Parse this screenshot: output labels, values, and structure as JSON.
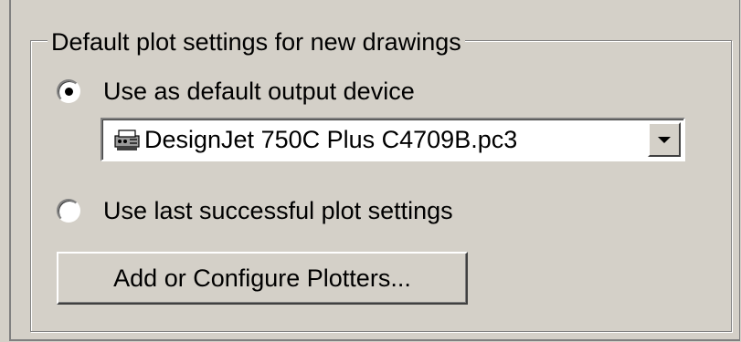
{
  "group": {
    "legend": "Default plot settings for new drawings"
  },
  "output_options": {
    "default_device_label": "Use as default output device",
    "last_settings_label": "Use last successful plot settings",
    "selected": "default_device"
  },
  "device_combo": {
    "value": "DesignJet 750C Plus C4709B.pc3",
    "icon": "plotter-icon"
  },
  "plotters_button": {
    "label": "Add or Configure Plotters..."
  }
}
